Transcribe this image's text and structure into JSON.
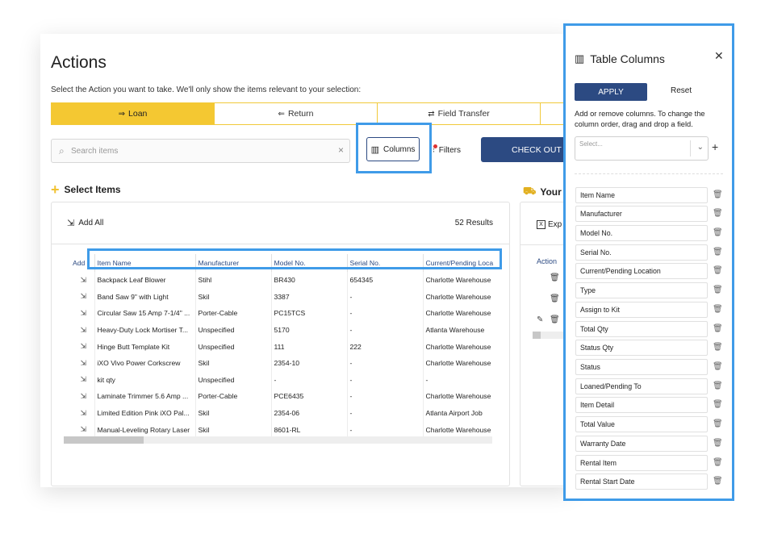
{
  "page": {
    "title": "Actions",
    "subtitle": "Select the Action you want to take. We'll only show the items relevant to your selection:"
  },
  "action_tabs": [
    {
      "label": "Loan",
      "icon": "⇒",
      "active": true
    },
    {
      "label": "Return",
      "icon": "⇐",
      "active": false
    },
    {
      "label": "Field Transfer",
      "icon": "⇄",
      "active": false
    }
  ],
  "toolbar": {
    "search_placeholder": "Search items",
    "columns_label": "Columns",
    "filters_label": "Filters",
    "checkout_label": "CHECK OUT"
  },
  "select_items": {
    "title": "Select Items",
    "add_all_label": "Add All",
    "results": "52 Results",
    "columns": [
      "Add",
      "Item Name",
      "Manufacturer",
      "Model No.",
      "Serial No.",
      "Current/Pending Loca"
    ],
    "rows": [
      [
        "Backpack Leaf Blower",
        "Stihl",
        "BR430",
        "654345",
        "Charlotte Warehouse"
      ],
      [
        "Band Saw 9\" with Light",
        "Skil",
        "3387",
        "-",
        "Charlotte Warehouse"
      ],
      [
        "Circular Saw 15 Amp 7-1/4\" ...",
        "Porter-Cable",
        "PC15TCS",
        "-",
        "Charlotte Warehouse"
      ],
      [
        "Heavy-Duty Lock Mortiser T...",
        "Unspecified",
        "5170",
        "-",
        "Atlanta Warehouse"
      ],
      [
        "Hinge Butt Template Kit",
        "Unspecified",
        "111",
        "222",
        "Charlotte Warehouse"
      ],
      [
        "iXO Vivo Power Corkscrew",
        "Skil",
        "2354-10",
        "-",
        "Charlotte Warehouse"
      ],
      [
        "kit qty",
        "Unspecified",
        "-",
        "-",
        "-"
      ],
      [
        "Laminate Trimmer 5.6 Amp ...",
        "Porter-Cable",
        "PCE6435",
        "-",
        "Charlotte Warehouse"
      ],
      [
        "Limited Edition Pink iXO Pal...",
        "Skil",
        "2354-06",
        "-",
        "Atlanta Airport Job"
      ],
      [
        "Manual-Leveling Rotary Laser",
        "Skil",
        "8601-RL",
        "-",
        "Charlotte Warehouse"
      ]
    ]
  },
  "your_panel": {
    "title": "Your C",
    "export_label": "Exp",
    "action_label": "Action"
  },
  "table_columns": {
    "title": "Table Columns",
    "apply_label": "APPLY",
    "reset_label": "Reset",
    "help": "Add or remove columns. To change the column order, drag and drop a field.",
    "select_placeholder": "Select...",
    "fields": [
      "Item Name",
      "Manufacturer",
      "Model No.",
      "Serial No.",
      "Current/Pending Location",
      "Type",
      "Assign to Kit",
      "Total Qty",
      "Status Qty",
      "Status",
      "Loaned/Pending To",
      "Item Detail",
      "Total Value",
      "Warranty Date",
      "Rental Item",
      "Rental Start Date"
    ]
  },
  "colors": {
    "accent": "#2c4a82",
    "highlight": "#3f9be8",
    "loan_tab": "#f4c832"
  }
}
